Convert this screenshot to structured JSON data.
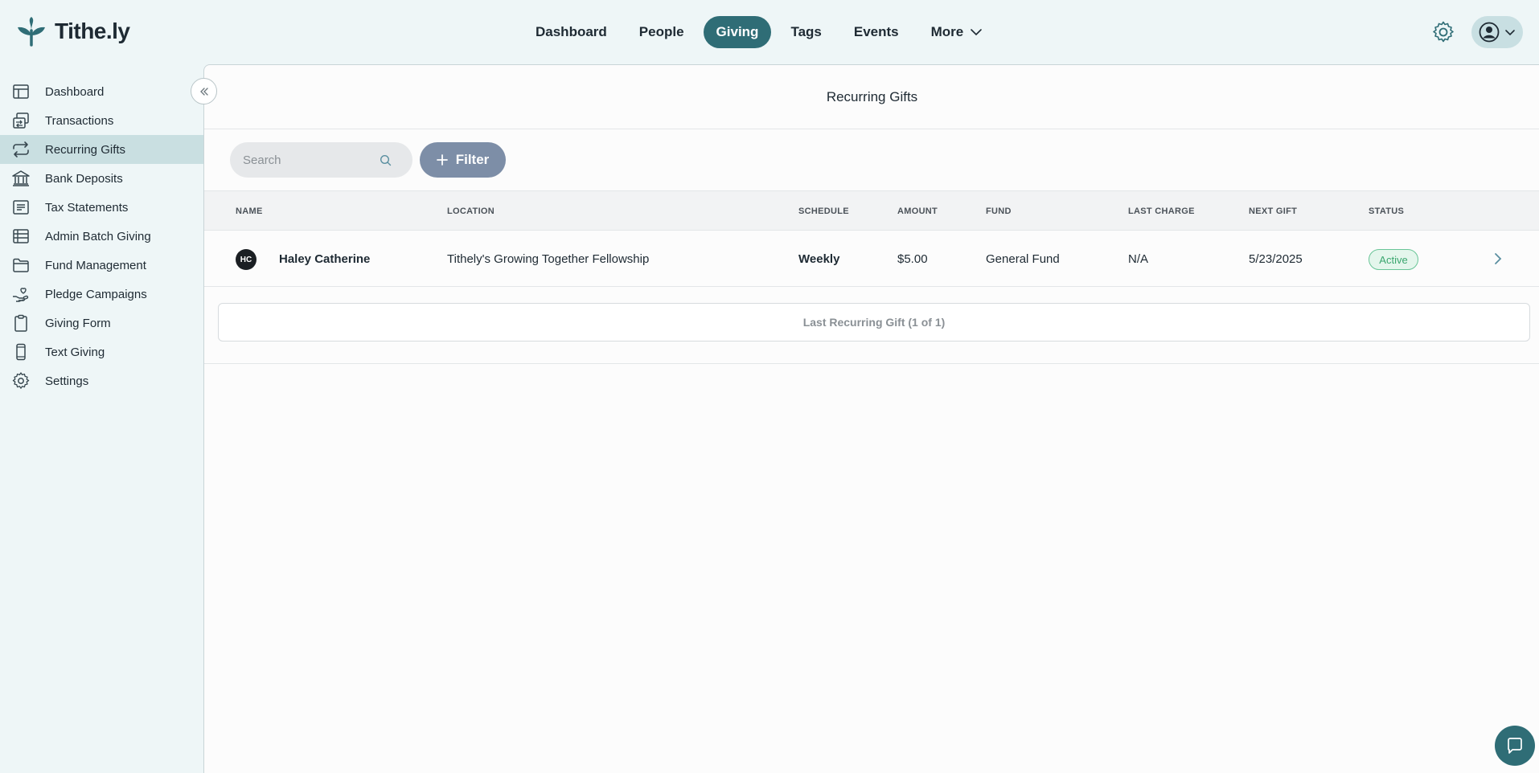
{
  "app": {
    "brand": "Tithe.ly",
    "accent": "#2f6d76"
  },
  "topnav": [
    {
      "label": "Dashboard",
      "active": false
    },
    {
      "label": "People",
      "active": false
    },
    {
      "label": "Giving",
      "active": true
    },
    {
      "label": "Tags",
      "active": false
    },
    {
      "label": "Events",
      "active": false
    },
    {
      "label": "More",
      "active": false
    }
  ],
  "sidebar": {
    "items": [
      {
        "label": "Dashboard",
        "icon": "dashboard-icon"
      },
      {
        "label": "Transactions",
        "icon": "transactions-icon"
      },
      {
        "label": "Recurring Gifts",
        "icon": "recurring-icon",
        "active": true
      },
      {
        "label": "Bank Deposits",
        "icon": "bank-icon"
      },
      {
        "label": "Tax Statements",
        "icon": "receipt-icon"
      },
      {
        "label": "Admin Batch Giving",
        "icon": "batch-icon"
      },
      {
        "label": "Fund Management",
        "icon": "folder-icon"
      },
      {
        "label": "Pledge Campaigns",
        "icon": "pledge-icon"
      },
      {
        "label": "Giving Form",
        "icon": "clipboard-icon"
      },
      {
        "label": "Text Giving",
        "icon": "phone-icon"
      },
      {
        "label": "Settings",
        "icon": "gear-icon"
      }
    ]
  },
  "main": {
    "title": "Recurring Gifts",
    "search": {
      "placeholder": "Search",
      "value": ""
    },
    "filter_label": "Filter",
    "table": {
      "headers": [
        "NAME",
        "LOCATION",
        "SCHEDULE",
        "AMOUNT",
        "FUND",
        "LAST CHARGE",
        "NEXT GIFT",
        "STATUS"
      ],
      "rows": [
        {
          "initials": "HC",
          "name": "Haley Catherine",
          "location": "Tithely's Growing Together Fellowship",
          "schedule": "Weekly",
          "amount": "$5.00",
          "fund": "General Fund",
          "last_charge": "N/A",
          "next_gift": "5/23/2025",
          "status": "Active"
        }
      ]
    },
    "pager": "Last Recurring Gift (1 of 1)"
  }
}
